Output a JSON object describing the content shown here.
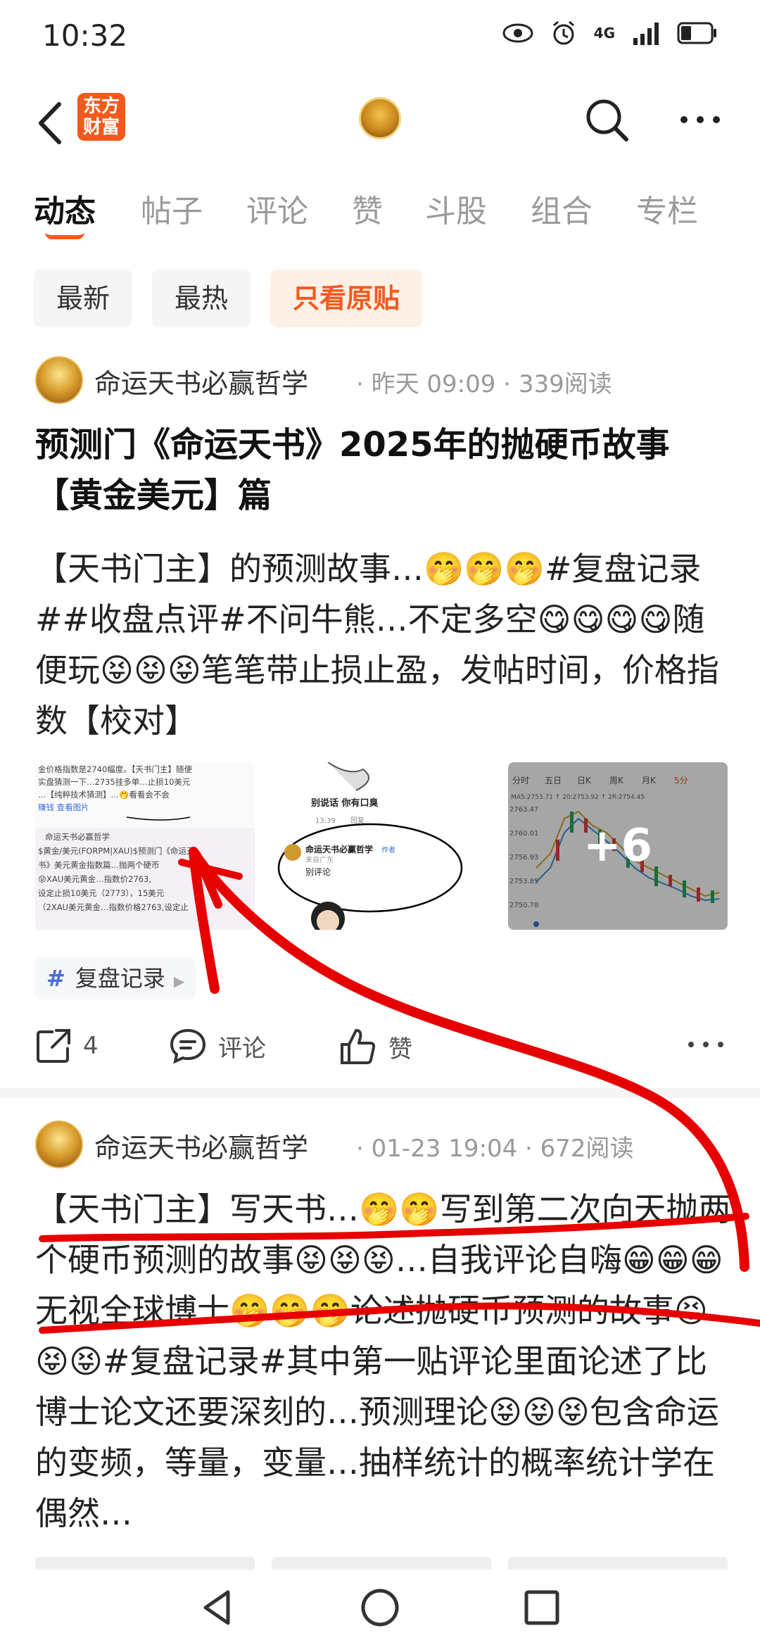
{
  "status_bar": {
    "time": "10:32",
    "network": "4G"
  },
  "header": {
    "logo_text": "东方\n财富"
  },
  "tabs": [
    {
      "label": "动态",
      "active": true
    },
    {
      "label": "帖子"
    },
    {
      "label": "评论"
    },
    {
      "label": "赞"
    },
    {
      "label": "斗股"
    },
    {
      "label": "组合"
    },
    {
      "label": "专栏"
    }
  ],
  "filters": [
    {
      "label": "最新"
    },
    {
      "label": "最热"
    },
    {
      "label": "只看原贴",
      "active": true
    }
  ],
  "posts": [
    {
      "author": "命运天书必赢哲学",
      "meta": "· 昨天 09:09 · 339阅读",
      "title": "预测门《命运天书》2025年的抛硬币故事【黄金美元】篇",
      "body": "【天书门主】的预测故事…🤭🤭🤭#复盘记录##收盘点评#不问牛熊…不定多空😋😋😋😋随便玩😝😝😝笔笔带止损止盈，发帖时间，价格指数【校对】",
      "thumbs": [
        {
          "lines": [
            "金价格指数是2740幅度。【天书门主】随便",
            "实盘猜测一下…2735挂多单…止损10美元",
            "…【纯粹技术猜测】…🤭看看会不会",
            "赚钱 查看图片",
            "命运天书必赢哲学",
            "$黄金/美元(FORPM|XAU)$预测门《命运天",
            "书》美元黄金指数篇…抛两个硬币",
            "😝XAU美元黄金…指数价2763,",
            "设定止损10美元（2773），15美元",
            "（2XAU美元黄金…指数价格2763,设定止"
          ]
        },
        {
          "top_caption": "别说话 你有口臭",
          "name": "命运天书必赢哲学",
          "badge": "作者",
          "sub": "来自广东",
          "reply": "别评论",
          "time": "13:39",
          "tag": "回复"
        },
        {
          "tabs": [
            "分时",
            "五日",
            "日K",
            "周K",
            "月K",
            "5分"
          ],
          "ma": "MA5:2753.71 ↑  20:2753.92 ↑  2R:2754.45",
          "prices": [
            "2763.47",
            "2760.01",
            "2756.93",
            "2753.85",
            "2750.78"
          ],
          "more_count": "+6"
        }
      ],
      "topic": "复盘记录",
      "shares": "4",
      "comment_label": "评论",
      "like_label": "赞"
    },
    {
      "author": "命运天书必赢哲学",
      "meta": "· 01-23 19:04 · 672阅读",
      "body": "【天书门主】写天书…🤭🤭写到第二次向天抛两个硬币预测的故事😝😝😝…自我评论自嗨😁😁😁无视全球博士🤭🤭🤭论述抛硬币预测的故事😝😝😝#复盘记录#其中第一贴评论里面论述了比博士论文还要深刻的…预测理论😝😝😝包含命运的变频，等量，变量…抽样统计的概率统计学在偶然…"
    }
  ],
  "colors": {
    "accent": "#f25a1d",
    "annotation": "#e60000"
  }
}
